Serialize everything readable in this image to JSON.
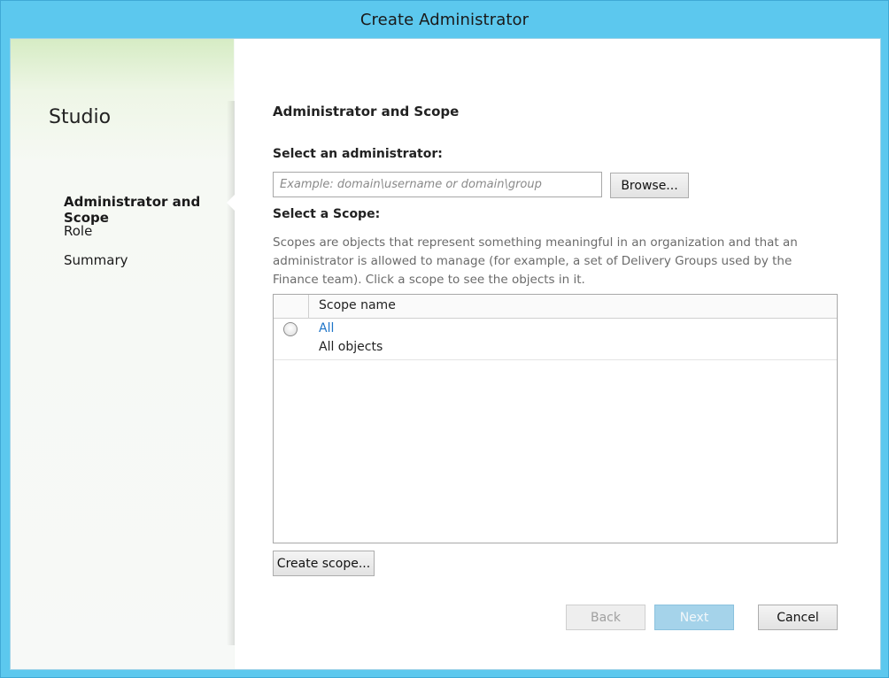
{
  "window": {
    "title": "Create Administrator"
  },
  "sidebar": {
    "brand": "Studio",
    "items": [
      {
        "label": "Administrator and Scope",
        "active": true
      },
      {
        "label": "Role",
        "active": false
      },
      {
        "label": "Summary",
        "active": false
      }
    ]
  },
  "main": {
    "section_title": "Administrator and Scope",
    "admin_label": "Select an administrator:",
    "admin_input": {
      "value": "",
      "placeholder": "Example: domain\\username or domain\\group"
    },
    "browse_label": "Browse...",
    "scope_label": "Select a Scope:",
    "scope_description": "Scopes are objects that represent something meaningful in an organization and that an administrator is allowed to manage (for example, a set of Delivery Groups used by the Finance team). Click a scope to see the objects in it.",
    "table": {
      "column_header": "Scope name",
      "rows": [
        {
          "name": "All",
          "description": "All objects",
          "selected": false
        }
      ]
    },
    "create_scope_label": "Create scope..."
  },
  "footer": {
    "back_label": "Back",
    "next_label": "Next",
    "cancel_label": "Cancel"
  },
  "colors": {
    "titlebar": "#5cc8ee",
    "link": "#1e74c8",
    "next_disabled": "#a5d3ea"
  }
}
